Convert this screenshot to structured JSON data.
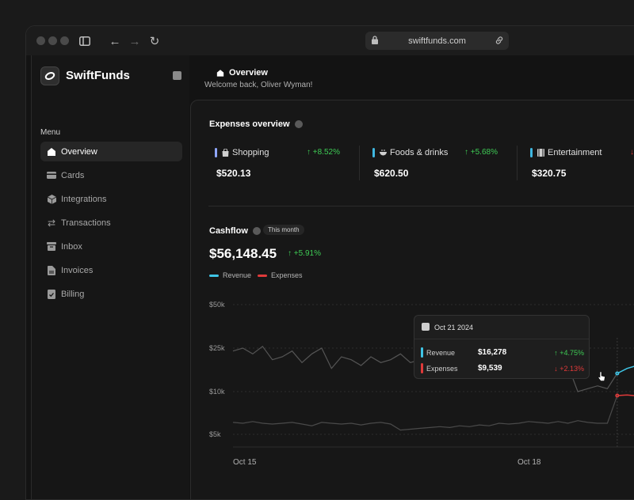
{
  "browser": {
    "url": "swiftfunds.com"
  },
  "app": {
    "name": "SwiftFunds"
  },
  "sidebar": {
    "menu_label": "Menu",
    "items": [
      {
        "label": "Overview",
        "icon": "home-icon",
        "active": true
      },
      {
        "label": "Cards",
        "icon": "card-icon"
      },
      {
        "label": "Integrations",
        "icon": "cube-icon"
      },
      {
        "label": "Transactions",
        "icon": "arrows-icon"
      },
      {
        "label": "Inbox",
        "icon": "inbox-icon"
      },
      {
        "label": "Invoices",
        "icon": "document-icon"
      },
      {
        "label": "Billing",
        "icon": "check-file-icon"
      }
    ]
  },
  "header": {
    "title": "Overview",
    "subtitle": "Welcome back, Oliver Wyman!"
  },
  "expenses": {
    "title": "Expenses overview",
    "cards": [
      {
        "name": "Shopping",
        "change": "+8.52%",
        "value": "$520.13",
        "color": "#8fa6ff",
        "trend": "up"
      },
      {
        "name": "Foods & drinks",
        "change": "+5.68%",
        "value": "$620.50",
        "color": "#3fb7e0",
        "trend": "up"
      },
      {
        "name": "Entertainment",
        "change": "",
        "value": "$320.75",
        "color": "#3fb7e0",
        "trend": "down"
      }
    ]
  },
  "cashflow": {
    "title": "Cashflow",
    "period": "This month",
    "total": "$56,148.45",
    "change": "+5.91%",
    "legend": [
      {
        "name": "Revenue",
        "color": "#3fc5e6"
      },
      {
        "name": "Expenses",
        "color": "#e03a3a"
      }
    ],
    "tooltip": {
      "date": "Oct 21 2024",
      "rows": [
        {
          "label": "Revenue",
          "value": "$16,278",
          "change": "+4.75%",
          "trend": "up",
          "color": "#3fc5e6"
        },
        {
          "label": "Expenses",
          "value": "$9,539",
          "change": "+2.13%",
          "trend": "down",
          "color": "#e03a3a"
        }
      ]
    }
  },
  "chart_data": {
    "type": "line",
    "y_ticks": [
      "$50k",
      "$25k",
      "$10k",
      "$5k"
    ],
    "x_ticks": [
      "Oct 15",
      "Oct 18"
    ],
    "series": [
      {
        "name": "Revenue",
        "values": [
          24000,
          25000,
          23000,
          26000,
          21000,
          22000,
          24000,
          20000,
          23000,
          25000,
          18000,
          22000,
          21000,
          19000,
          22000,
          20000,
          21000,
          23000,
          20000,
          21000,
          19000,
          20000,
          22000,
          18000,
          17000,
          22000,
          21000,
          20000,
          24000,
          20000,
          21000,
          19000,
          20000,
          21000,
          19000,
          10000,
          11000,
          12000,
          11000,
          16278,
          18000,
          19000,
          17000,
          21000,
          20000
        ]
      },
      {
        "name": "Expenses",
        "values": [
          6400,
          6300,
          6500,
          6300,
          6200,
          6300,
          6400,
          6200,
          6000,
          6400,
          6300,
          6200,
          6300,
          6100,
          6300,
          6400,
          6200,
          5500,
          5600,
          5700,
          5800,
          5900,
          5800,
          6000,
          5900,
          6100,
          6000,
          6300,
          6200,
          6300,
          6500,
          6400,
          6300,
          6500,
          6300,
          6600,
          6400,
          6300,
          6300,
          9539,
          9600,
          9500,
          9400,
          9300,
          9200
        ]
      }
    ]
  }
}
